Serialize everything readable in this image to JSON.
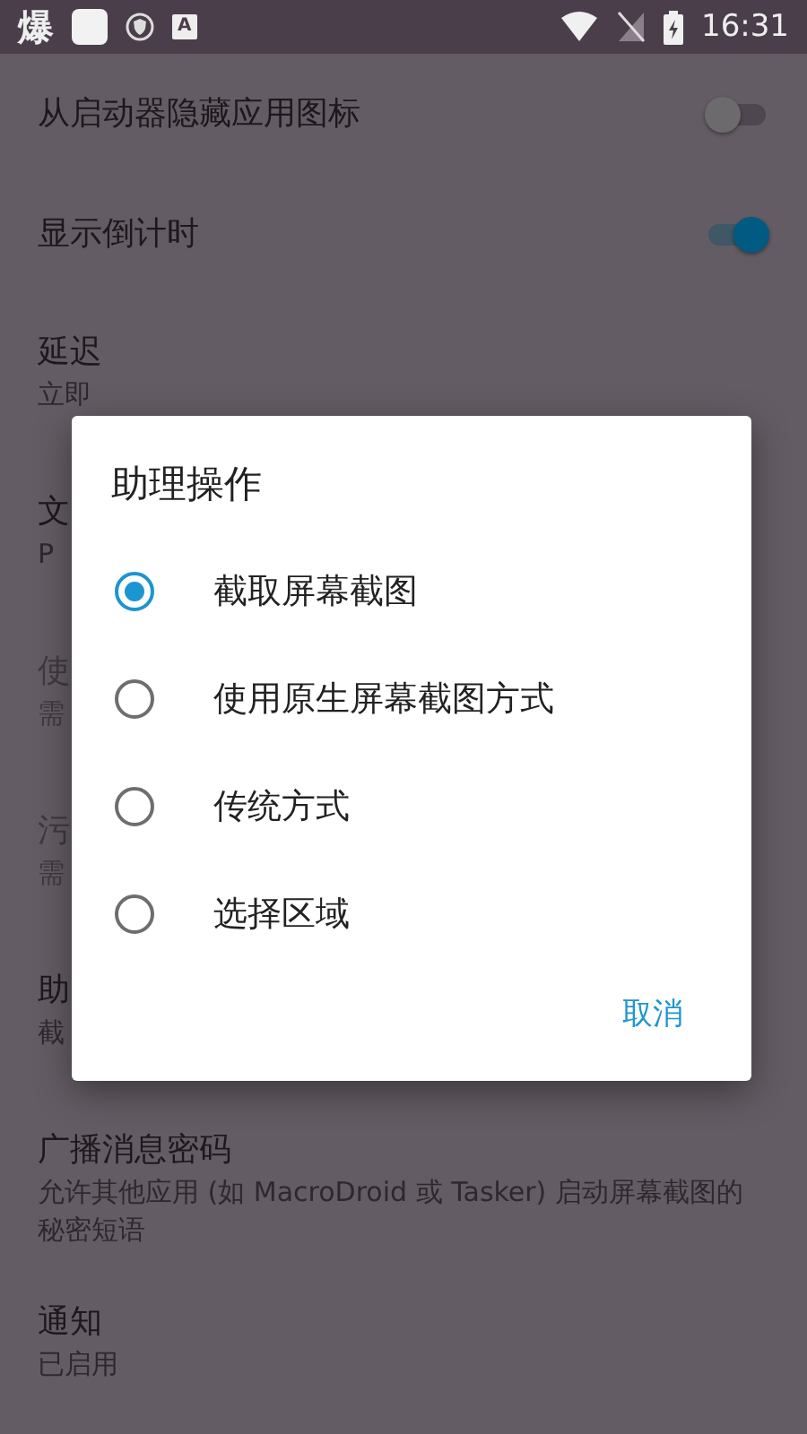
{
  "status_bar": {
    "notification_glyph": "爆",
    "badge_letter": "A",
    "time": "16:31"
  },
  "settings": [
    {
      "kind": "switch",
      "title": "从启动器隐藏应用图标",
      "on": false
    },
    {
      "kind": "switch",
      "title": "显示倒计时",
      "on": true
    },
    {
      "kind": "text",
      "title": "延迟",
      "subtitle": "立即",
      "disabled": false
    },
    {
      "kind": "text",
      "title": "文",
      "subtitle": "P",
      "disabled": false
    },
    {
      "kind": "text",
      "title": "使",
      "subtitle": "需",
      "disabled": true
    },
    {
      "kind": "text",
      "title": "污",
      "subtitle": "需",
      "disabled": true
    },
    {
      "kind": "text",
      "title": "助",
      "subtitle": "截",
      "disabled": false
    },
    {
      "kind": "text",
      "title": "广播消息密码",
      "subtitle": "允许其他应用 (如 MacroDroid 或 Tasker) 启动屏幕截图的秘密短语",
      "disabled": false
    },
    {
      "kind": "text",
      "title": "通知",
      "subtitle": "已启用",
      "disabled": false
    }
  ],
  "dialog": {
    "title": "助理操作",
    "options": [
      {
        "label": "截取屏幕截图",
        "selected": true
      },
      {
        "label": "使用原生屏幕截图方式",
        "selected": false
      },
      {
        "label": "传统方式",
        "selected": false
      },
      {
        "label": "选择区域",
        "selected": false
      }
    ],
    "cancel_button": "取消"
  }
}
